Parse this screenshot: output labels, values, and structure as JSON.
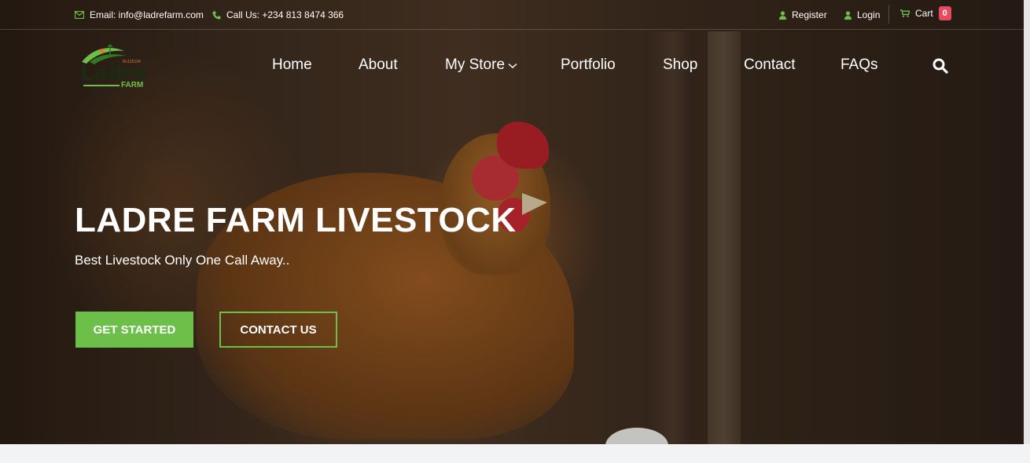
{
  "topbar": {
    "email": "Email: info@ladrefarm.com",
    "phone": "Call Us: +234 813 8474 366",
    "register": "Register",
    "login": "Login",
    "cart_label": "Cart",
    "cart_count": "0"
  },
  "logo": {
    "name": "Ladre",
    "sub": "FARM",
    "reg": "Rc125134"
  },
  "nav": {
    "home": "Home",
    "about": "About",
    "store": "My Store",
    "portfolio": "Portfolio",
    "shop": "Shop",
    "contact": "Contact",
    "faqs": "FAQs"
  },
  "hero": {
    "title": "LADRE FARM LIVESTOCK",
    "subtitle": "Best Livestock Only One Call Away..",
    "primary_button": "GET STARTED",
    "secondary_button": "CONTACT US"
  },
  "icons": {
    "email": "envelope-icon",
    "phone": "phone-icon",
    "register": "user-icon",
    "login": "user-icon",
    "cart": "cart-icon",
    "store_dropdown": "chevron-down-icon",
    "search": "search-icon"
  },
  "colors": {
    "accent": "#6cc04a",
    "badge": "#e84a5f"
  }
}
